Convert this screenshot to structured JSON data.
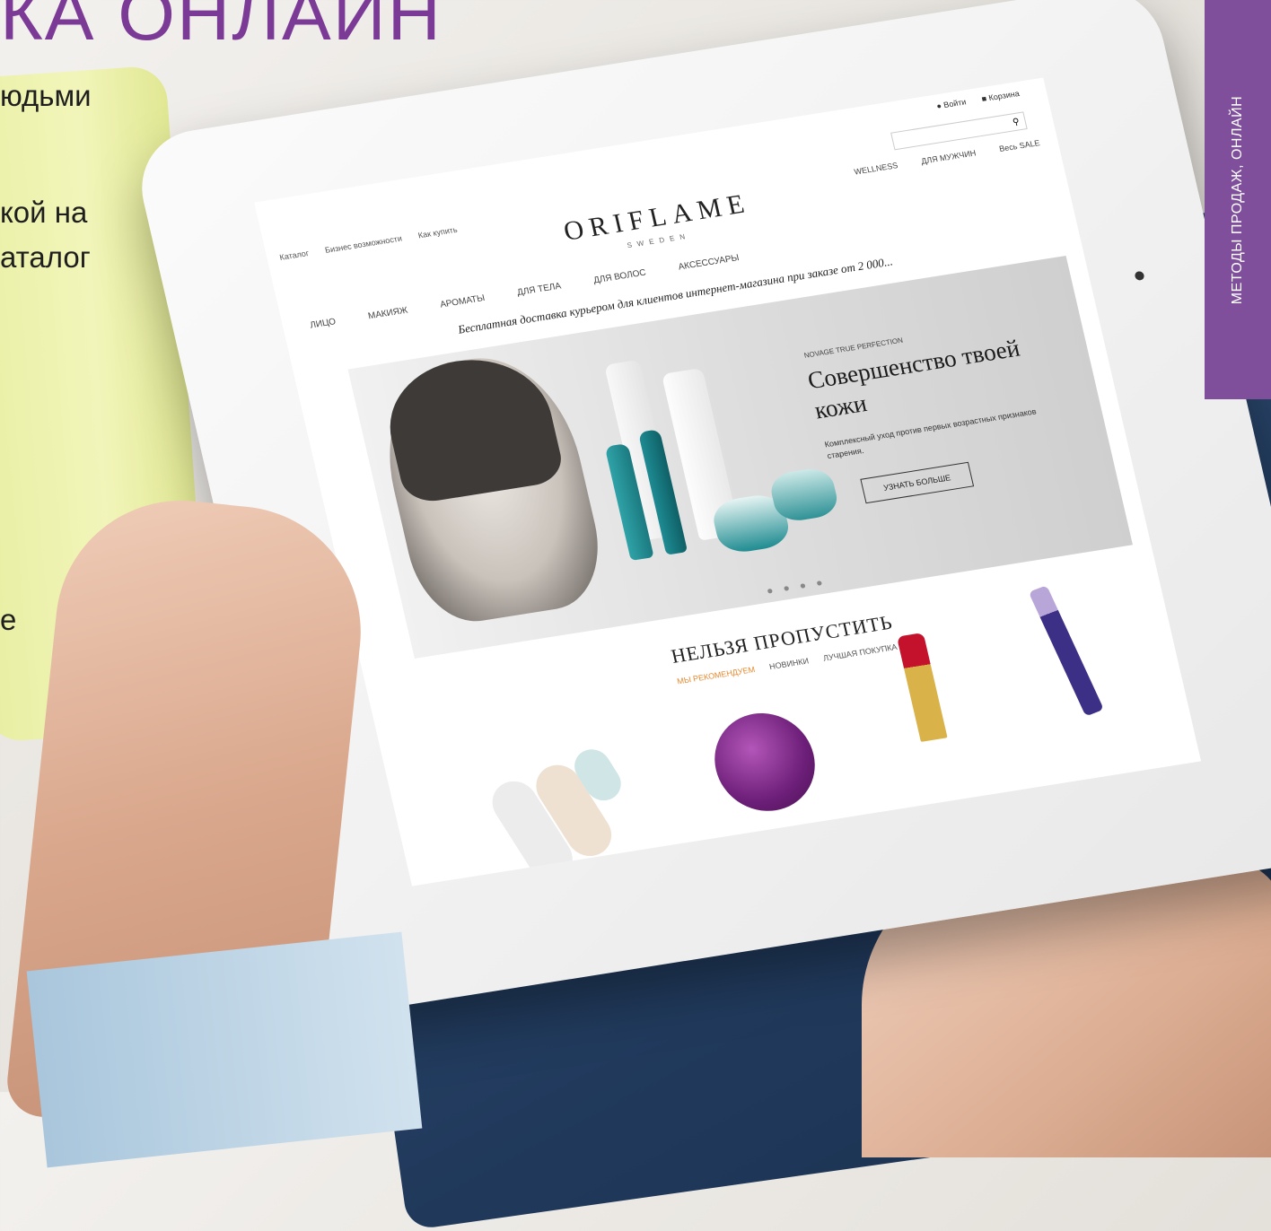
{
  "slide": {
    "title": "КА ОНЛАЙН",
    "lines": [
      "юдьми",
      "кой на",
      "аталог",
      "е"
    ],
    "side_label": "МЕТОДЫ ПРОДАЖ, ОНЛАЙН",
    "accent_color": "#7f4f9c"
  },
  "site": {
    "utility": {
      "login": "Войти",
      "cart": "Корзина"
    },
    "search_icon": "search-icon",
    "top_links": [
      "Каталог",
      "Бизнес возможности",
      "Как купить"
    ],
    "logo": "ORIFLAME",
    "logo_sub": "SWEDEN",
    "main_nav": [
      "ЛИЦО",
      "МАКИЯЖ",
      "АРОМАТЫ",
      "ДЛЯ ТЕЛА",
      "ДЛЯ ВОЛОС",
      "АКСЕССУАРЫ"
    ],
    "right_nav": [
      "WELLNESS",
      "ДЛЯ МУЖЧИН",
      "Весь SALE"
    ],
    "promo": "Бесплатная доставка курьером для клиентов интернет-магазина при заказе от 2 000...",
    "hero": {
      "brand": "NOVAGE TRUE PERFECTION",
      "title": "Совершенство твоей кожи",
      "desc": "Комплексный уход против первых возрастных признаков старения.",
      "button": "УЗНАТЬ БОЛЬШЕ",
      "dots": "● ● ● ●"
    },
    "section_title": "НЕЛЬЗЯ ПРОПУСТИТЬ",
    "tabs": [
      "МЫ РЕКОМЕНДУЕМ",
      "НОВИНКИ",
      "ЛУЧШАЯ ПОКУПКА"
    ]
  }
}
